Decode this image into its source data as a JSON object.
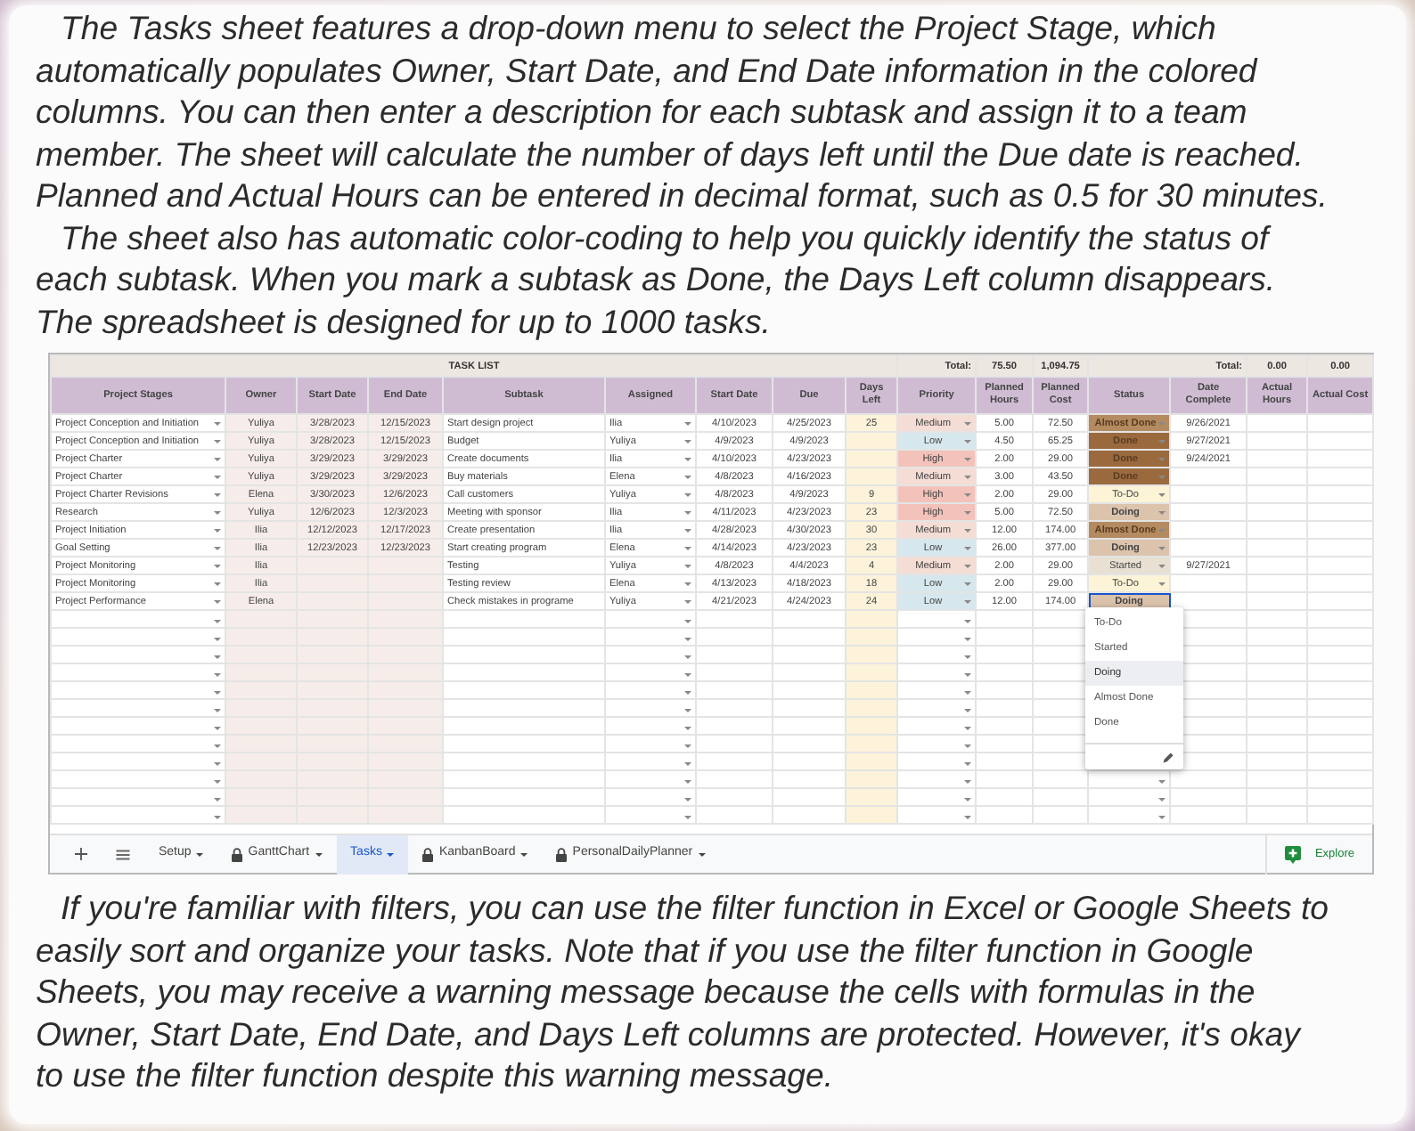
{
  "intro": [
    "The Tasks sheet features a drop-down menu to select the Project Stage, which\nautomatically populates Owner, Start Date, and End Date information in the colored\ncolumns. You can then enter a description for each subtask and assign it to a team\nmember. The sheet will calculate the number of days left until the Due date is reached.\nPlanned and Actual Hours can be entered in decimal format, such as 0.5 for 30 minutes.",
    "The sheet also has automatic color-coding to help you quickly identify the status of\neach subtask. When you mark a subtask as Done, the Days Left column disappears.\nThe spreadsheet is designed for up to 1000 tasks."
  ],
  "sheet": {
    "title": "TASK LIST",
    "total_label_1": "Total:",
    "total_hours": "75.50",
    "total_cost": "1,094.75",
    "total_label_2": "Total:",
    "total_actual_hours": "0.00",
    "total_actual_cost": "0.00",
    "columns": [
      "Project Stages",
      "Owner",
      "Start Date",
      "End Date",
      "Subtask",
      "Assigned",
      "Start Date",
      "Due",
      "Days Left",
      "Priority",
      "Planned Hours",
      "Planned Cost",
      "Status",
      "Date Complete",
      "Actual Hours",
      "Actual Cost"
    ],
    "rows": [
      {
        "stage": "Project Conception and Initiation",
        "owner": "Yuliya",
        "start_date": "3/28/2023",
        "end_date": "12/15/2023",
        "subtask": "Start design project",
        "assigned": "Ilia",
        "sub_start": "4/10/2023",
        "due": "4/25/2023",
        "days_left": "25",
        "priority": {
          "text": "Medium",
          "color": "#f4ddd5"
        },
        "planned_hours": "5.00",
        "planned_cost": "72.50",
        "status": {
          "text": "Almost Done",
          "color": "#b48a60",
          "selected": false
        },
        "date_complete": "9/26/2021"
      },
      {
        "stage": "Project Conception and Initiation",
        "owner": "Yuliya",
        "start_date": "3/28/2023",
        "end_date": "12/15/2023",
        "subtask": "Budget",
        "assigned": "Yuliya",
        "sub_start": "4/9/2023",
        "due": "4/9/2023",
        "priority": {
          "text": "Low",
          "color": "#d6e7ed"
        },
        "planned_hours": "4.50",
        "planned_cost": "65.25",
        "status": {
          "text": "Done",
          "color": "#9a6a3e",
          "selected": false
        },
        "date_complete": "9/27/2021"
      },
      {
        "stage": "Project Charter",
        "owner": "Yuliya",
        "start_date": "3/29/2023",
        "end_date": "3/29/2023",
        "subtask": "Create documents",
        "assigned": "Ilia",
        "sub_start": "4/10/2023",
        "due": "4/23/2023",
        "priority": {
          "text": "High",
          "color": "#f3c3bb"
        },
        "planned_hours": "2.00",
        "planned_cost": "29.00",
        "status": {
          "text": "Done",
          "color": "#9a6a3e",
          "selected": false
        },
        "date_complete": "9/24/2021"
      },
      {
        "stage": "Project Charter",
        "owner": "Yuliya",
        "start_date": "3/29/2023",
        "end_date": "3/29/2023",
        "subtask": "Buy materials",
        "assigned": "Elena",
        "sub_start": "4/8/2023",
        "due": "4/16/2023",
        "priority": {
          "text": "Medium",
          "color": "#f4ddd5"
        },
        "planned_hours": "3.00",
        "planned_cost": "43.50",
        "status": {
          "text": "Done",
          "color": "#9a6a3e",
          "selected": false
        }
      },
      {
        "stage": "Project Charter Revisions",
        "owner": "Elena",
        "start_date": "3/30/2023",
        "end_date": "12/6/2023",
        "subtask": "Call customers",
        "assigned": "Yuliya",
        "sub_start": "4/8/2023",
        "due": "4/9/2023",
        "days_left": "9",
        "priority": {
          "text": "High",
          "color": "#f3c3bb"
        },
        "planned_hours": "2.00",
        "planned_cost": "29.00",
        "status": {
          "text": "To-Do",
          "color": "#fdf4d8",
          "selected": false
        }
      },
      {
        "stage": "Research",
        "owner": "Yuliya",
        "start_date": "12/6/2023",
        "end_date": "12/3/2023",
        "subtask": "Meeting with sponsor",
        "assigned": "Ilia",
        "sub_start": "4/11/2023",
        "due": "4/23/2023",
        "days_left": "23",
        "priority": {
          "text": "High",
          "color": "#f3c3bb"
        },
        "planned_hours": "5.00",
        "planned_cost": "72.50",
        "status": {
          "text": "Doing",
          "color": "#dcc3ac",
          "selected": false
        }
      },
      {
        "stage": "Project Initiation",
        "owner": "Ilia",
        "start_date": "12/12/2023",
        "end_date": "12/17/2023",
        "subtask": "Create presentation",
        "assigned": "Ilia",
        "sub_start": "4/28/2023",
        "due": "4/30/2023",
        "days_left": "30",
        "priority": {
          "text": "Medium",
          "color": "#f4ddd5"
        },
        "planned_hours": "12.00",
        "planned_cost": "174.00",
        "status": {
          "text": "Almost Done",
          "color": "#b48a60",
          "selected": false
        }
      },
      {
        "stage": "Goal Setting",
        "owner": "Ilia",
        "start_date": "12/23/2023",
        "end_date": "12/23/2023",
        "subtask": "Start creating program",
        "assigned": "Elena",
        "sub_start": "4/14/2023",
        "due": "4/23/2023",
        "days_left": "23",
        "priority": {
          "text": "Low",
          "color": "#d6e7ed"
        },
        "planned_hours": "26.00",
        "planned_cost": "377.00",
        "status": {
          "text": "Doing",
          "color": "#dcc3ac",
          "selected": false
        }
      },
      {
        "stage": "Project Monitoring",
        "owner": "Ilia",
        "subtask": "Testing",
        "assigned": "Yuliya",
        "sub_start": "4/8/2023",
        "due": "4/4/2023",
        "days_left": "4",
        "priority": {
          "text": "Medium",
          "color": "#f4ddd5"
        },
        "planned_hours": "2.00",
        "planned_cost": "29.00",
        "status": {
          "text": "Started",
          "color": "#e8e0d3",
          "selected": false
        },
        "date_complete": "9/27/2021"
      },
      {
        "stage": "Project Monitoring",
        "owner": "Ilia",
        "subtask": "Testing review",
        "assigned": "Elena",
        "sub_start": "4/13/2023",
        "due": "4/18/2023",
        "days_left": "18",
        "priority": {
          "text": "Low",
          "color": "#d6e7ed"
        },
        "planned_hours": "2.00",
        "planned_cost": "29.00",
        "status": {
          "text": "To-Do",
          "color": "#fdf4d8",
          "selected": false
        }
      },
      {
        "stage": "Project Performance",
        "owner": "Elena",
        "subtask": "Check mistakes in programe",
        "assigned": "Yuliya",
        "sub_start": "4/21/2023",
        "due": "4/24/2023",
        "days_left": "24",
        "priority": {
          "text": "Low",
          "color": "#d6e7ed"
        },
        "planned_hours": "12.00",
        "planned_cost": "174.00",
        "status": {
          "text": "Doing",
          "color": "#dcc3ac",
          "selected": true
        }
      }
    ],
    "status_menu": [
      {
        "label": "To-Do",
        "selected": false
      },
      {
        "label": "Started",
        "selected": false
      },
      {
        "label": "Doing",
        "selected": true
      },
      {
        "label": "Almost Done",
        "selected": false
      },
      {
        "label": "Done",
        "selected": false
      }
    ],
    "tabs": [
      {
        "label": "Setup",
        "locked": false,
        "selected": false
      },
      {
        "label": "GanttChart",
        "locked": true,
        "selected": false
      },
      {
        "label": "Tasks",
        "locked": false,
        "selected": true
      },
      {
        "label": "KanbanBoard",
        "locked": true,
        "selected": false
      },
      {
        "label": "PersonalDailyPlanner",
        "locked": true,
        "selected": false
      }
    ],
    "explore": "Explore"
  },
  "outro": "If you're familiar with filters, you can use the filter function in Excel or Google Sheets to\neasily sort and organize your tasks. Note that if you use the filter function in Google\nSheets, you may receive a warning message because the cells with formulas in the\nOwner, Start Date, End Date, and Days Left columns are protected. However, it's okay\nto use the filter function despite this warning message."
}
